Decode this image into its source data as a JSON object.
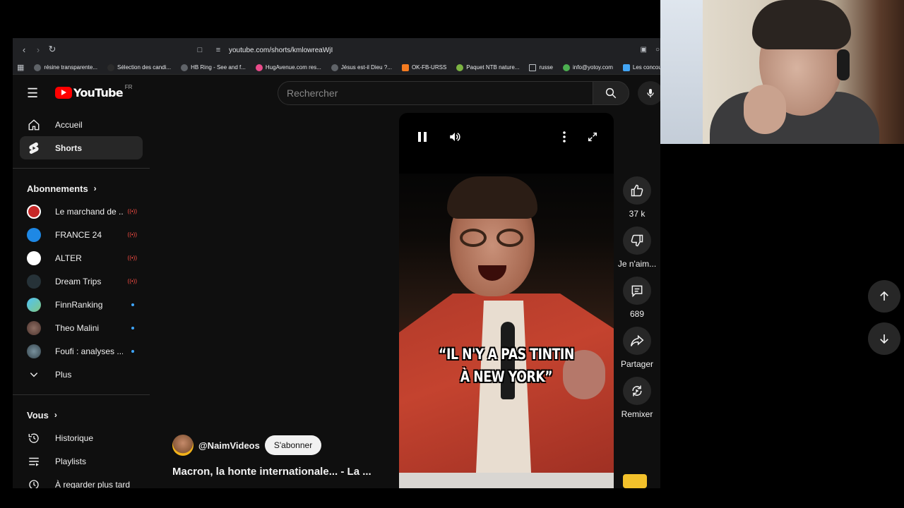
{
  "browser": {
    "url": "youtube.com/shorts/kmlowreaWjI",
    "bookmarks": [
      {
        "label": "résine transparente...",
        "color": "#5f6368"
      },
      {
        "label": "Sélection des candi...",
        "color": "#2b2b2b"
      },
      {
        "label": "HB Ring - See and f...",
        "color": "#5f6368"
      },
      {
        "label": "HugAvenue.com res...",
        "color": "#e94b8a"
      },
      {
        "label": "Jésus est-il Dieu ?...",
        "color": "#5f6368"
      },
      {
        "label": "OK-FB-URSS",
        "color": "#f47b20"
      },
      {
        "label": "Paquet NTB nature...",
        "color": "#7cb342"
      },
      {
        "label": "russe",
        "color": "#5f6368"
      },
      {
        "label": "info@yotoy.com",
        "color": "#4caf50"
      },
      {
        "label": "Les concours",
        "color": "#42a5f5"
      }
    ]
  },
  "youtube": {
    "logo_text": "YouTube",
    "region": "FR",
    "search_placeholder": "Rechercher",
    "nav": [
      {
        "label": "Accueil",
        "icon": "home-icon",
        "active": false
      },
      {
        "label": "Shorts",
        "icon": "shorts-icon",
        "active": true
      }
    ],
    "subscriptions_heading": "Abonnements",
    "subscriptions": [
      {
        "name": "Le marchand de ...",
        "status": "live",
        "color": "#c62828"
      },
      {
        "name": "FRANCE 24",
        "status": "live",
        "color": "#1e88e5"
      },
      {
        "name": "ALTER",
        "status": "live",
        "color": "#ffffff"
      },
      {
        "name": "Dream Trips",
        "status": "live",
        "color": "#263238"
      },
      {
        "name": "FinnRanking",
        "status": "new",
        "color": "#4fc3f7"
      },
      {
        "name": "Theo Malini",
        "status": "new",
        "color": "#6d4c41"
      },
      {
        "name": "Foufi : analyses ...",
        "status": "new",
        "color": "#546e7a"
      }
    ],
    "more_label": "Plus",
    "you_heading": "Vous",
    "you_items": [
      {
        "label": "Historique",
        "icon": "history-icon"
      },
      {
        "label": "Playlists",
        "icon": "playlists-icon"
      },
      {
        "label": "À regarder plus tard",
        "icon": "watch-later-icon"
      }
    ]
  },
  "short": {
    "caption_line1": "“IL N'Y A PAS TINTIN",
    "caption_line2": "À NEW YORK”",
    "channel": "@NaimVideos",
    "subscribe_label": "S'abonner",
    "title": "Macron, la honte internationale... - La ...",
    "likes": "37 k",
    "dislike_label": "Je n'aim...",
    "comments": "689",
    "share_label": "Partager",
    "remix_label": "Remixer"
  },
  "colors": {
    "accent_red": "#ff0000",
    "live_red": "#ff4e45",
    "new_dot": "#3ea6ff"
  }
}
